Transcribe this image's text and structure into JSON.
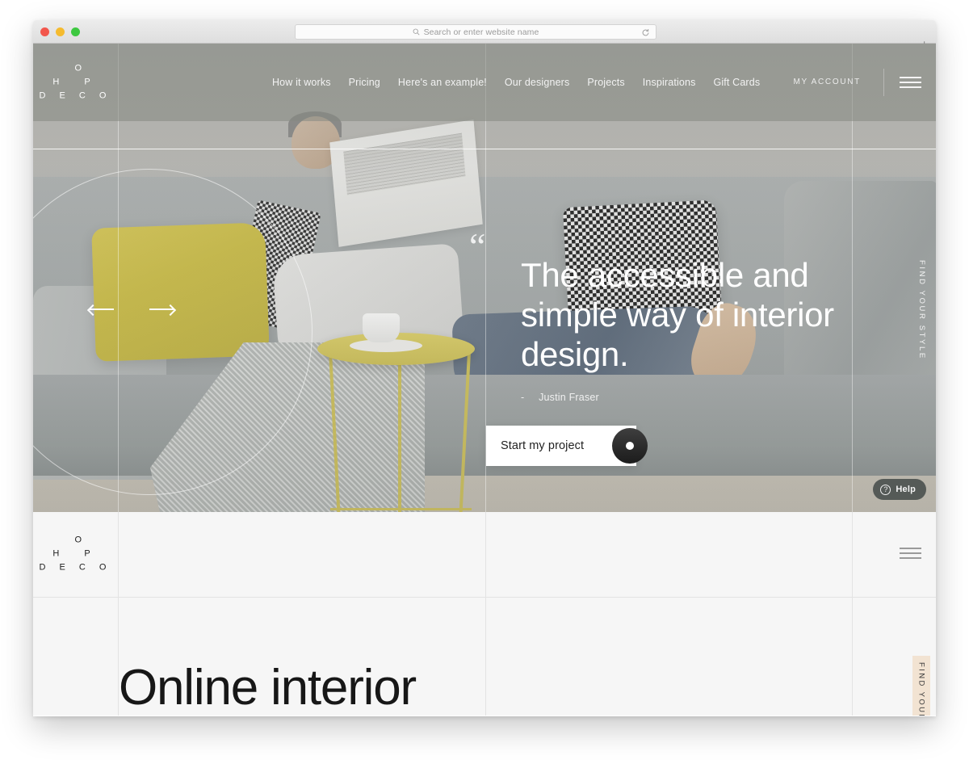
{
  "browser": {
    "traffic_lights": [
      "close",
      "minimize",
      "maximize"
    ],
    "address_placeholder": "Search or enter website name",
    "address_value": "",
    "search_icon": "search-icon",
    "reload_icon": "reload-icon",
    "new_tab_label": "+"
  },
  "site": {
    "logo": {
      "line1": "O",
      "line2": "H P",
      "line3": "D E C O"
    },
    "nav": [
      {
        "label": "How it works"
      },
      {
        "label": "Pricing"
      },
      {
        "label": "Here's an example!"
      },
      {
        "label": "Our designers"
      },
      {
        "label": "Projects"
      },
      {
        "label": "Inspirations"
      },
      {
        "label": "Gift Cards"
      }
    ],
    "account_label": "MY ACCOUNT",
    "menu_icon": "hamburger-icon"
  },
  "hero": {
    "quote_glyph": "“",
    "heading": "The accessible and simple way of interior design.",
    "author_dash": "-",
    "author": "Justin Fraser",
    "cta_label": "Start my project",
    "cta_icon": "dot-circle-icon",
    "prev_icon": "arrow-left-icon",
    "next_icon": "arrow-right-icon",
    "side_tab_label": "FIND YOUR STYLE",
    "help_label": "Help",
    "help_icon": "question-circle-icon"
  },
  "section2": {
    "heading": "Online interior",
    "side_tab_label": "FIND YOUR",
    "menu_icon": "hamburger-icon"
  },
  "colors": {
    "page_bg": "#f6f6f6",
    "accent_yellow": "#d8c957",
    "tab_beige": "#f2e3d2",
    "heading_dark": "#171717",
    "help_pill": "#555a57"
  }
}
